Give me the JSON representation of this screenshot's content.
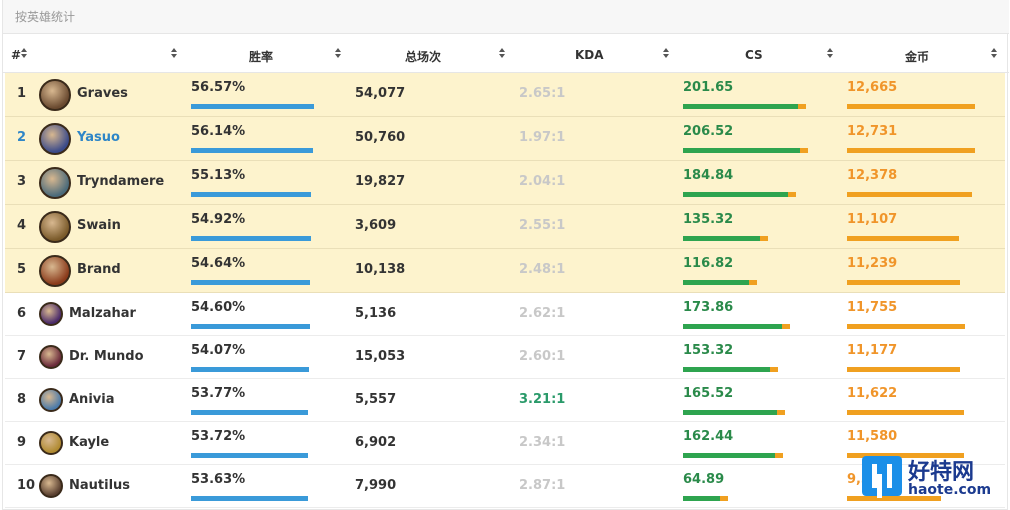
{
  "page": {
    "title": "按英雄统计"
  },
  "columns": [
    "#",
    "胜率",
    "总场次",
    "KDA",
    "CS",
    "金币"
  ],
  "colors": {
    "highlight_row": "#fdf3cd",
    "win_bar": "#3a9ad9",
    "cs_bar_fill": "#2ea44f",
    "gold": "#f0a020",
    "link": "#2f86c7",
    "kda_good": "#2a9a6a"
  },
  "rows": [
    {
      "rank": "1",
      "name": "Graves",
      "win_rate": "56.57%",
      "win_frac": 0.5657,
      "games": "54,077",
      "kda": "2.65:1",
      "cs": "201.65",
      "cs_val": 201.65,
      "gold": "12,665",
      "gold_val": 12665,
      "highlight": true,
      "link": false,
      "kda_good": false
    },
    {
      "rank": "2",
      "name": "Yasuo",
      "win_rate": "56.14%",
      "win_frac": 0.5614,
      "games": "50,760",
      "kda": "1.97:1",
      "cs": "206.52",
      "cs_val": 206.52,
      "gold": "12,731",
      "gold_val": 12731,
      "highlight": true,
      "link": true,
      "kda_good": false
    },
    {
      "rank": "3",
      "name": "Tryndamere",
      "win_rate": "55.13%",
      "win_frac": 0.5513,
      "games": "19,827",
      "kda": "2.04:1",
      "cs": "184.84",
      "cs_val": 184.84,
      "gold": "12,378",
      "gold_val": 12378,
      "highlight": true,
      "link": false,
      "kda_good": false
    },
    {
      "rank": "4",
      "name": "Swain",
      "win_rate": "54.92%",
      "win_frac": 0.5492,
      "games": "3,609",
      "kda": "2.55:1",
      "cs": "135.32",
      "cs_val": 135.32,
      "gold": "11,107",
      "gold_val": 11107,
      "highlight": true,
      "link": false,
      "kda_good": false
    },
    {
      "rank": "5",
      "name": "Brand",
      "win_rate": "54.64%",
      "win_frac": 0.5464,
      "games": "10,138",
      "kda": "2.48:1",
      "cs": "116.82",
      "cs_val": 116.82,
      "gold": "11,239",
      "gold_val": 11239,
      "highlight": true,
      "link": false,
      "kda_good": false
    },
    {
      "rank": "6",
      "name": "Malzahar",
      "win_rate": "54.60%",
      "win_frac": 0.546,
      "games": "5,136",
      "kda": "2.62:1",
      "cs": "173.86",
      "cs_val": 173.86,
      "gold": "11,755",
      "gold_val": 11755,
      "highlight": false,
      "link": false,
      "kda_good": false
    },
    {
      "rank": "7",
      "name": "Dr. Mundo",
      "win_rate": "54.07%",
      "win_frac": 0.5407,
      "games": "15,053",
      "kda": "2.60:1",
      "cs": "153.32",
      "cs_val": 153.32,
      "gold": "11,177",
      "gold_val": 11177,
      "highlight": false,
      "link": false,
      "kda_good": false
    },
    {
      "rank": "8",
      "name": "Anivia",
      "win_rate": "53.77%",
      "win_frac": 0.5377,
      "games": "5,557",
      "kda": "3.21:1",
      "cs": "165.52",
      "cs_val": 165.52,
      "gold": "11,622",
      "gold_val": 11622,
      "highlight": false,
      "link": false,
      "kda_good": true
    },
    {
      "rank": "9",
      "name": "Kayle",
      "win_rate": "53.72%",
      "win_frac": 0.5372,
      "games": "6,902",
      "kda": "2.34:1",
      "cs": "162.44",
      "cs_val": 162.44,
      "gold": "11,580",
      "gold_val": 11580,
      "highlight": false,
      "link": false,
      "kda_good": false
    },
    {
      "rank": "10",
      "name": "Nautilus",
      "win_rate": "53.63%",
      "win_frac": 0.5363,
      "games": "7,990",
      "kda": "2.87:1",
      "cs": "64.89",
      "cs_val": 64.89,
      "gold": "9,3",
      "gold_val": 9300,
      "highlight": false,
      "link": false,
      "kda_good": false
    }
  ],
  "watermark": {
    "text_cn": "好特网",
    "url": "haote.com",
    "icon": "haote-logo-icon"
  }
}
